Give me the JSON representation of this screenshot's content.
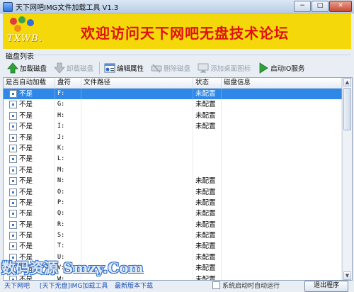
{
  "window": {
    "title": "天下网吧IMG文件加载工具 V1.3",
    "controls": {
      "minimize": "−",
      "maximize": "□",
      "close": "✕"
    }
  },
  "banner": {
    "logo_text": "TXWB.",
    "slogan": "欢迎访问天下网吧无盘技术论坛",
    "logo_dot_colors": [
      "#e23b3b",
      "#3aa34a",
      "#2f6fd6",
      "#f08a1a"
    ]
  },
  "group": {
    "label": "磁盘列表"
  },
  "toolbar": {
    "items": [
      {
        "label": "加载磁盘",
        "icon": "green-up-arrow-icon",
        "enabled": true
      },
      {
        "label": "卸载磁盘",
        "icon": "gray-down-arrow-icon",
        "enabled": false
      },
      {
        "label": "编辑属性",
        "icon": "properties-icon",
        "enabled": true
      },
      {
        "label": "删除磁盘",
        "icon": "delete-drive-icon",
        "enabled": false
      },
      {
        "label": "添加桌面图标",
        "icon": "desktop-shortcut-icon",
        "enabled": false
      },
      {
        "label": "启动IO服务",
        "icon": "green-play-icon",
        "enabled": true
      }
    ]
  },
  "listview": {
    "columns": [
      "是否自动加载",
      "盘符",
      "文件路径",
      "状态",
      "磁盘信息"
    ],
    "rows": [
      {
        "auto": "不是",
        "drive": "F:",
        "path": "",
        "status": "未配置",
        "info": "",
        "selected": true
      },
      {
        "auto": "不是",
        "drive": "G:",
        "path": "",
        "status": "未配置",
        "info": ""
      },
      {
        "auto": "不是",
        "drive": "H:",
        "path": "",
        "status": "未配置",
        "info": ""
      },
      {
        "auto": "不是",
        "drive": "I:",
        "path": "",
        "status": "未配置",
        "info": ""
      },
      {
        "auto": "不是",
        "drive": "J:",
        "path": "",
        "status": "",
        "info": ""
      },
      {
        "auto": "不是",
        "drive": "K:",
        "path": "",
        "status": "",
        "info": ""
      },
      {
        "auto": "不是",
        "drive": "L:",
        "path": "",
        "status": "",
        "info": ""
      },
      {
        "auto": "不是",
        "drive": "M:",
        "path": "",
        "status": "",
        "info": ""
      },
      {
        "auto": "不是",
        "drive": "N:",
        "path": "",
        "status": "未配置",
        "info": ""
      },
      {
        "auto": "不是",
        "drive": "O:",
        "path": "",
        "status": "未配置",
        "info": ""
      },
      {
        "auto": "不是",
        "drive": "P:",
        "path": "",
        "status": "未配置",
        "info": ""
      },
      {
        "auto": "不是",
        "drive": "Q:",
        "path": "",
        "status": "未配置",
        "info": ""
      },
      {
        "auto": "不是",
        "drive": "R:",
        "path": "",
        "status": "未配置",
        "info": ""
      },
      {
        "auto": "不是",
        "drive": "S:",
        "path": "",
        "status": "未配置",
        "info": ""
      },
      {
        "auto": "不是",
        "drive": "T:",
        "path": "",
        "status": "未配置",
        "info": ""
      },
      {
        "auto": "不是",
        "drive": "U:",
        "path": "",
        "status": "未配置",
        "info": ""
      },
      {
        "auto": "不是",
        "drive": "V:",
        "path": "",
        "status": "未配置",
        "info": ""
      },
      {
        "auto": "不是",
        "drive": "W:",
        "path": "",
        "status": "未配置",
        "info": ""
      }
    ]
  },
  "watermark": "数码资源 Smzy.Com",
  "bottom": {
    "link1": "天下网吧",
    "link2": "[天下无盘]IMG加载工具",
    "link3": "最新版本下载",
    "checkbox_label": "系统启动时自动运行",
    "exit_button": "退出程序"
  }
}
